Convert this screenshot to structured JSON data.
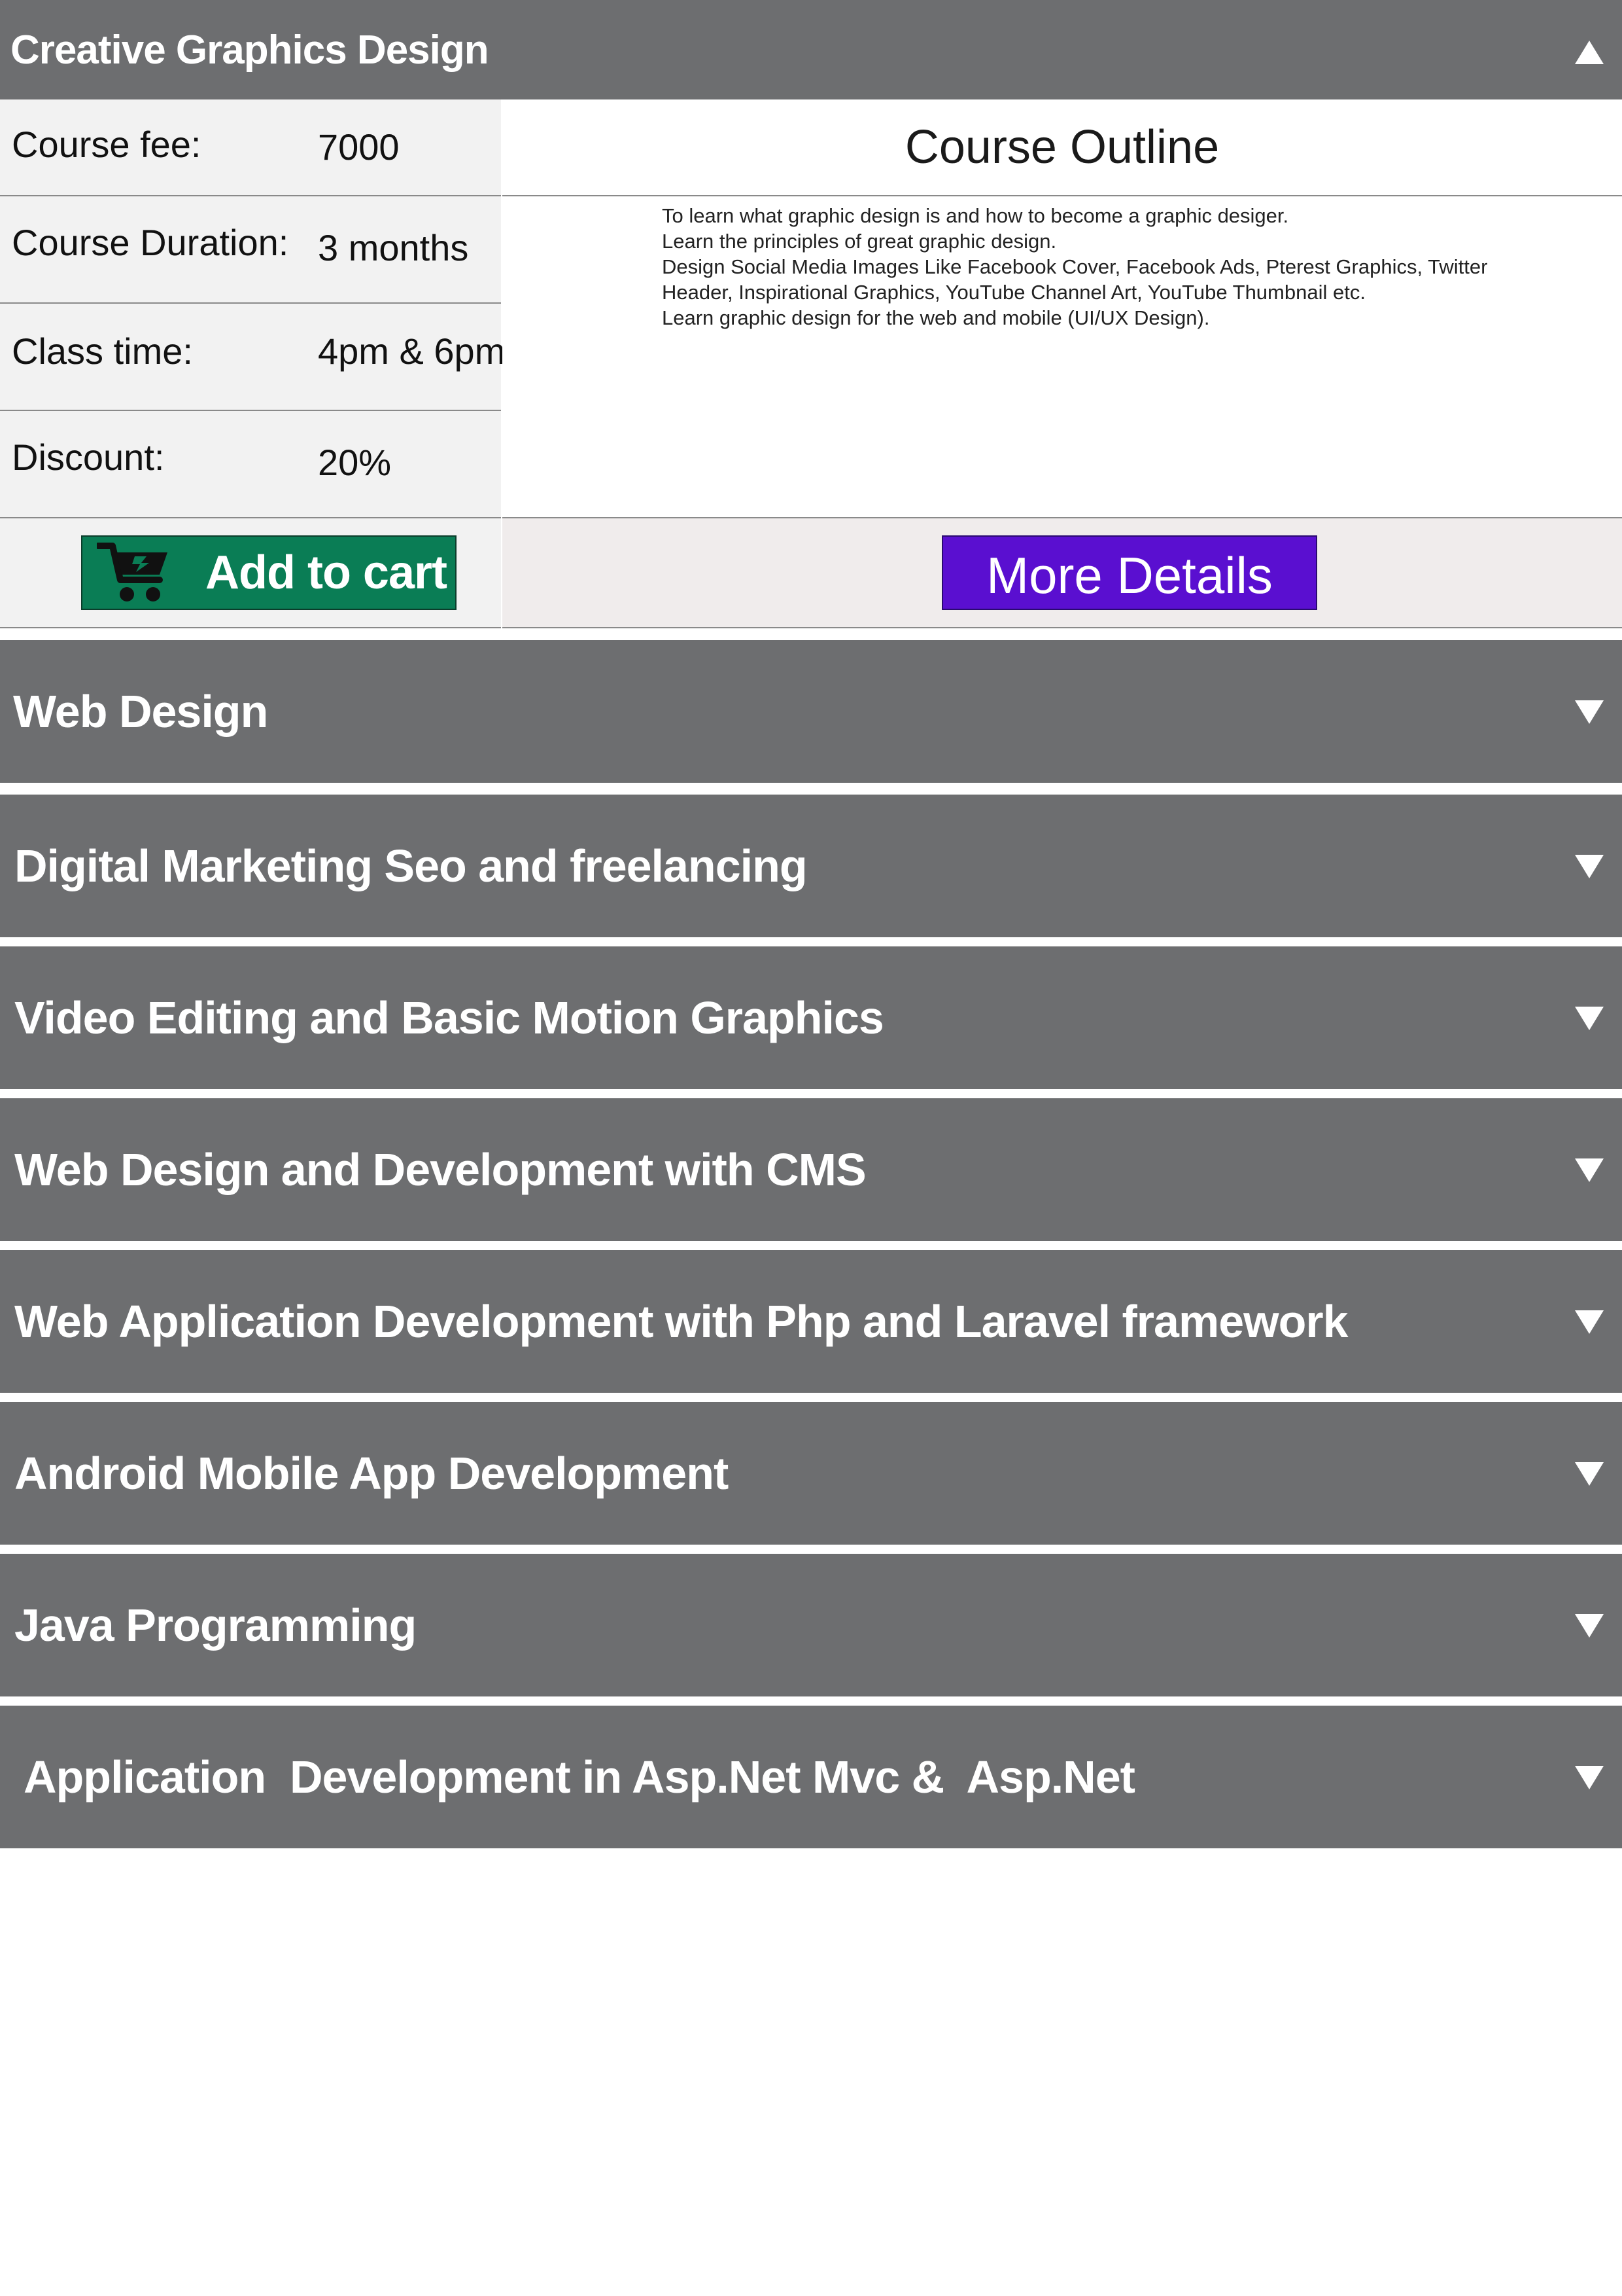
{
  "active_course": {
    "title": "Creative Graphics Design",
    "fields": [
      {
        "label": "Course fee:",
        "value": "7000"
      },
      {
        "label": "Course Duration:",
        "value": "3 months"
      },
      {
        "label": "Class time:",
        "value": "4pm & 6pm"
      },
      {
        "label": "Discount:",
        "value": "20%"
      }
    ],
    "outline_title": "Course Outline",
    "outline_lines": [
      "To learn what graphic design is and how to become a graphic desiger.",
      "Learn the principles of great graphic design.",
      "Design Social Media Images Like Facebook Cover, Facebook Ads, Pterest Graphics, Twitter",
      "Header, Inspirational Graphics, YouTube Channel Art, YouTube Thumbnail etc.",
      "Learn graphic design for the web and mobile (UI/UX Design)."
    ],
    "add_to_cart_label": "Add to cart",
    "more_details_label": "More Details"
  },
  "courses": [
    "Web Design",
    "Digital Marketing Seo and freelancing",
    "Video Editing and Basic Motion Graphics",
    "Web Design and Development with CMS",
    "Web Application Development with Php and Laravel framework",
    "Android Mobile App Development",
    "Java Programming",
    "Application  Development in Asp.Net Mvc &  Asp.Net"
  ],
  "colors": {
    "header_gray": "#6d6e70",
    "cart_green": "#0a7d55",
    "details_purple": "#5a0fd0"
  },
  "icons": {
    "expanded": "triangle-up-icon",
    "collapsed": "triangle-down-icon",
    "cart": "cart-icon"
  }
}
